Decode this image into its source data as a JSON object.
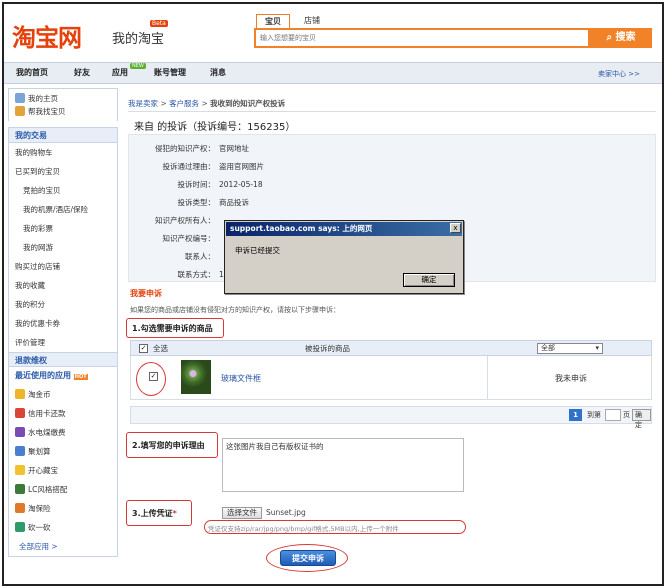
{
  "header": {
    "logo": "淘宝网",
    "logo_sub": "我的淘宝",
    "beta": "Beta",
    "search_tabs": [
      "宝贝",
      "店铺"
    ],
    "search_placeholder": "输入您想要的宝贝",
    "search_button": "搜索"
  },
  "nav": {
    "items": [
      "我的首页",
      "好友",
      "应用",
      "账号管理",
      "消息"
    ],
    "new_tag": "NEW",
    "seller_center": "卖家中心 >>"
  },
  "sidebar": {
    "top_links": [
      "我的主页",
      "帮我找宝贝"
    ],
    "trade_head": "我的交易",
    "trade_links": [
      "我的购物车",
      "已买到的宝贝",
      "竞拍的宝贝",
      "我的机票/酒店/保险",
      "我的彩票",
      "我的网游",
      "购买过的店铺",
      "我的收藏",
      "我的积分",
      "我的优惠卡券",
      "评价管理"
    ],
    "rights_head": "退款维权",
    "apps_head": "最近使用的应用",
    "hot": "HOT",
    "app_links": [
      "淘金币",
      "信用卡还款",
      "水电煤缴费",
      "聚划算",
      "开心藏宝",
      "LC风格搭配",
      "淘保险",
      "砍一砍"
    ],
    "all_apps": "全部应用 >"
  },
  "breadcrumb": {
    "a": "我是卖家",
    "b": "客户服务",
    "current": "我收到的知识产权投诉"
  },
  "page_title": "来自      的投诉（投诉编号：156235）",
  "info": [
    {
      "label": "侵犯的知识产权：",
      "value": "官网地址"
    },
    {
      "label": "投诉通过理由：",
      "value": "盗用官网图片"
    },
    {
      "label": "投诉时间：",
      "value": "2012-05-18"
    },
    {
      "label": "投诉类型：",
      "value": "商品投诉"
    },
    {
      "label": "知识产权所有人：",
      "value": ""
    },
    {
      "label": "知识产权编号：",
      "value": ""
    },
    {
      "label": "联系人：",
      "value": ""
    },
    {
      "label": "联系方式：",
      "value": "139"
    }
  ],
  "appeal": {
    "title": "我要申诉",
    "desc": "如果您的商品或店铺没有侵犯对方的知识产权，请按以下步骤申诉：",
    "step1": "1.勾选需要申诉的商品",
    "select_all": "全选",
    "col_goods": "被投诉的商品",
    "filter": "全部",
    "item_name": "玻璃文件框",
    "item_status": "我未申诉",
    "page": "1",
    "goto_prefix": "到第",
    "goto_suffix": "页",
    "goto_btn": "确定",
    "step2": "2.填写您的申诉理由",
    "reason": "这张图片我自己有版权证书的",
    "step3": "3.上传凭证",
    "required": "*",
    "choose_file": "选择文件",
    "file_name": "Sunset.jpg",
    "hint": "凭证仅支持zip/rar/jpg/png/bmp/gif格式,5MB以内,上传一个附件",
    "submit": "提交申诉"
  },
  "dialog": {
    "title": "support.taobao.com says: 上的网页",
    "message": "申诉已经提交",
    "ok": "确定",
    "close": "x"
  }
}
